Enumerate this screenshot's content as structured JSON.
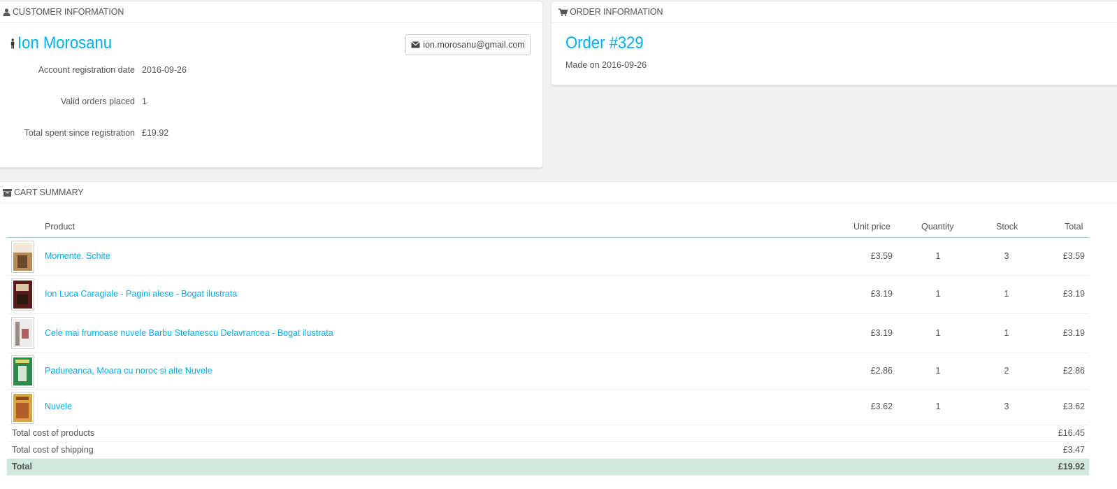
{
  "customer_panel": {
    "heading": "CUSTOMER INFORMATION",
    "name": "Ion Morosanu",
    "email": "ion.morosanu@gmail.com",
    "rows": [
      {
        "label": "Account registration date",
        "value": "2016-09-26"
      },
      {
        "label": "Valid orders placed",
        "value": "1"
      },
      {
        "label": "Total spent since registration",
        "value": "£19.92"
      }
    ]
  },
  "order_panel": {
    "heading": "ORDER INFORMATION",
    "title": "Order #329",
    "made_on": "Made on 2016-09-26"
  },
  "cart_panel": {
    "heading": "CART SUMMARY",
    "columns": {
      "product": "Product",
      "unit_price": "Unit price",
      "quantity": "Quantity",
      "stock": "Stock",
      "total": "Total"
    },
    "items": [
      {
        "name": "Momente. Schite",
        "unit_price": "£3.59",
        "quantity": "1",
        "stock": "3",
        "total": "£3.59",
        "cover_color": "#c8a57a"
      },
      {
        "name": "Ion Luca Caragiale - Pagini alese - Bogat ilustrata",
        "unit_price": "£3.19",
        "quantity": "1",
        "stock": "1",
        "total": "£3.19",
        "cover_color": "#5a1a1a"
      },
      {
        "name": "Cele mai frumoase nuvele Barbu Stefanescu Delavrancea - Bogat ilustrata",
        "unit_price": "£3.19",
        "quantity": "1",
        "stock": "1",
        "total": "£3.19",
        "cover_color": "#e6e6e6"
      },
      {
        "name": "Padureanca, Moara cu noroc si alte Nuvele",
        "unit_price": "£2.86",
        "quantity": "1",
        "stock": "2",
        "total": "£2.86",
        "cover_color": "#2d8a4a"
      },
      {
        "name": "Nuvele",
        "unit_price": "£3.62",
        "quantity": "1",
        "stock": "3",
        "total": "£3.62",
        "cover_color": "#d9a441"
      }
    ],
    "summary": [
      {
        "label": "Total cost of products",
        "value": "£16.45"
      },
      {
        "label": "Total cost of shipping",
        "value": "£3.47"
      }
    ],
    "total": {
      "label": "Total",
      "value": "£19.92"
    }
  },
  "colors": {
    "accent": "#00aff0",
    "total_row": "#cfe8db"
  },
  "icons": {
    "customer": "user-icon",
    "order": "cart-icon",
    "cart": "archive-icon",
    "email": "envelope-icon",
    "gender": "male-icon"
  }
}
